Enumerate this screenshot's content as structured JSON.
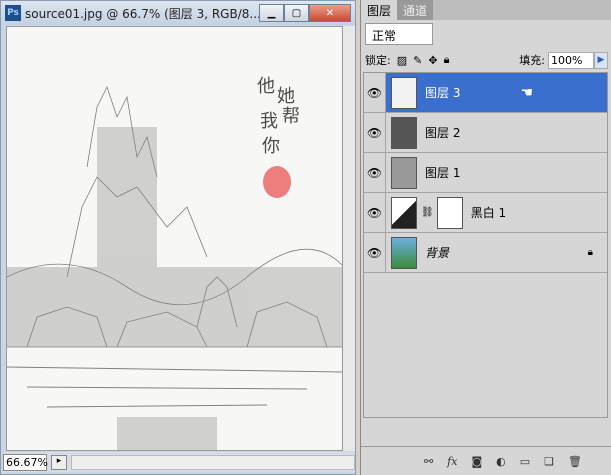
{
  "document": {
    "app_icon": "Ps",
    "title": "source01.jpg @ 66.7% (图层 3, RGB/8...",
    "zoom": "66.67%"
  },
  "window_buttons": {
    "minimize": "▭",
    "maximize": "▢",
    "close": "X"
  },
  "panel": {
    "tabs": [
      "图层",
      "通道"
    ],
    "blend_mode": "正常",
    "lock_label": "锁定:",
    "fill_label": "填充:",
    "fill_value": "100%",
    "layers": [
      {
        "name": "图层 3",
        "selected": true
      },
      {
        "name": "图层 2",
        "selected": false
      },
      {
        "name": "图层 1",
        "selected": false
      },
      {
        "name": "黑白 1",
        "selected": false
      },
      {
        "name": "背景",
        "selected": false
      }
    ],
    "toolbar": [
      "link-icon",
      "fx",
      "mask-icon",
      "adjustment-icon",
      "group-icon",
      "new-layer-icon",
      "trash-icon"
    ]
  }
}
